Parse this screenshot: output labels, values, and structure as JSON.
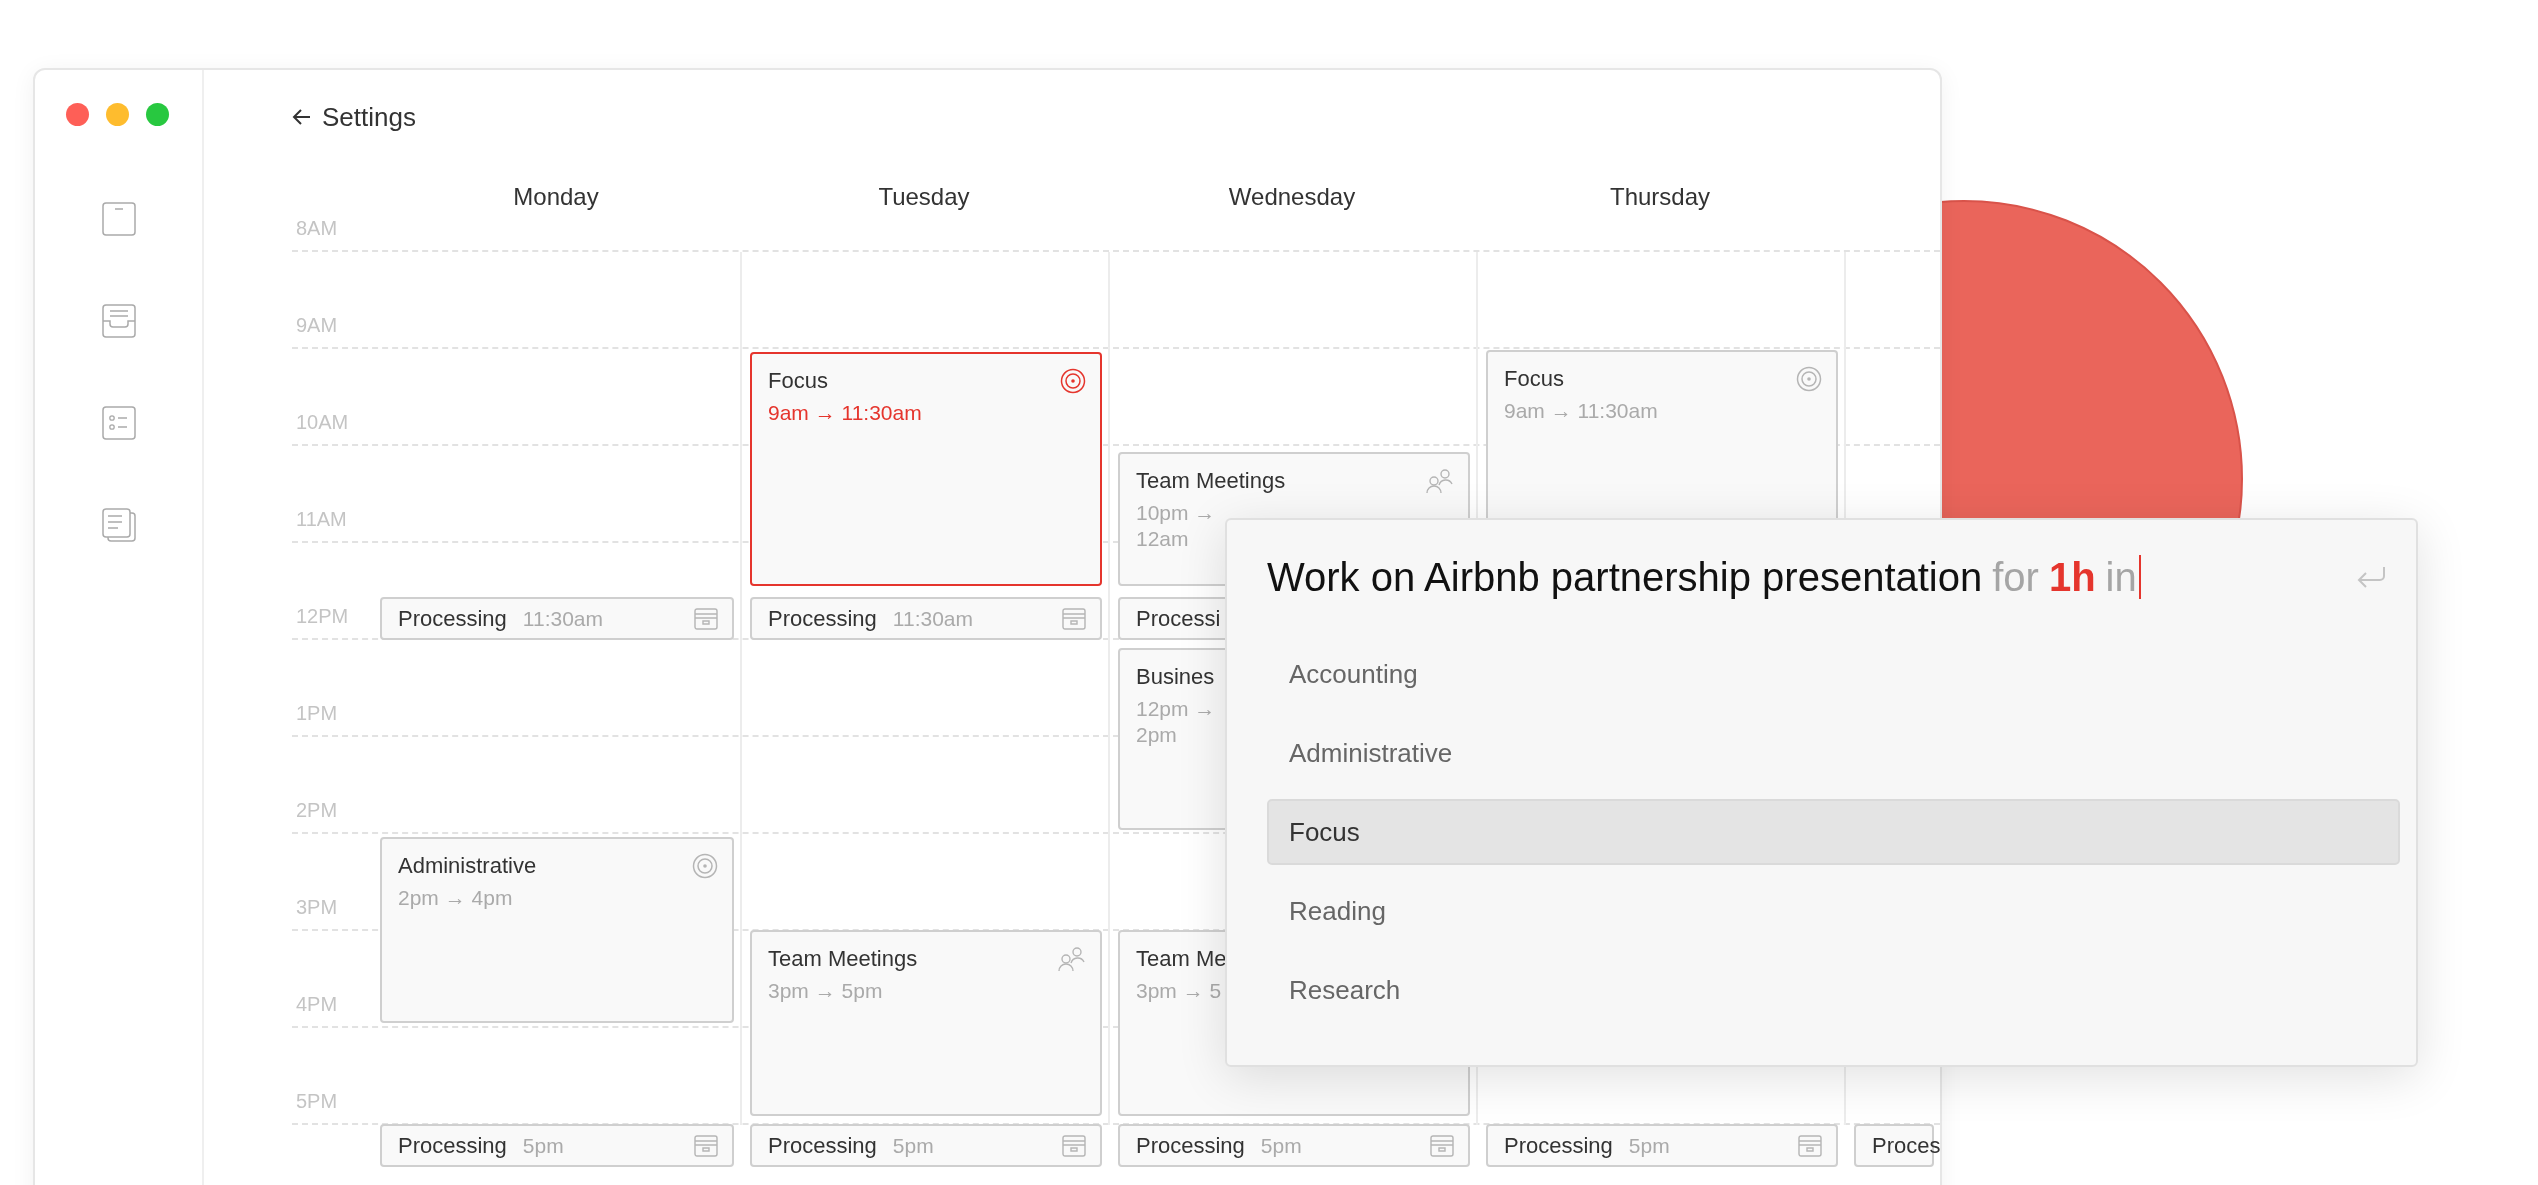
{
  "back_link": {
    "label": "Settings"
  },
  "sidebar": {
    "items": [
      {
        "selected": false
      },
      {
        "selected": false
      },
      {
        "selected": false
      },
      {
        "selected": false
      }
    ]
  },
  "hours": [
    "8AM",
    "9AM",
    "10AM",
    "11AM",
    "12PM",
    "1PM",
    "2PM",
    "3PM",
    "4PM",
    "5PM"
  ],
  "days": [
    {
      "name": "Monday",
      "events": [
        {
          "kind": "processing",
          "title": "Processing",
          "time": "11:30am",
          "selected": false
        },
        {
          "kind": "session",
          "title": "Administrative",
          "time": "2pm → 4pm",
          "selected": false
        },
        {
          "kind": "processing",
          "title": "Processing",
          "time": "5pm",
          "selected": false
        }
      ]
    },
    {
      "name": "Tuesday",
      "events": [
        {
          "kind": "session",
          "title": "Focus",
          "time": "9am → 11:30am",
          "selected": true
        },
        {
          "kind": "processing",
          "title": "Processing",
          "time": "11:30am",
          "selected": false
        },
        {
          "kind": "meeting",
          "title": "Team Meetings",
          "time": "3pm → 5pm",
          "selected": false
        },
        {
          "kind": "processing",
          "title": "Processing",
          "time": "5pm",
          "selected": false
        }
      ]
    },
    {
      "name": "Wednesday",
      "events": [
        {
          "kind": "meeting",
          "title": "Team Meetings",
          "time": "10pm →\n12am",
          "selected": false
        },
        {
          "kind": "bar",
          "title": "Processi",
          "selected": false
        },
        {
          "kind": "block",
          "title": "Busines",
          "time": "12pm →\n2pm",
          "selected": false
        },
        {
          "kind": "block",
          "title": "Team Me",
          "time": "3pm → 5",
          "selected": false
        },
        {
          "kind": "processing",
          "title": "Processing",
          "time": "5pm",
          "selected": false
        }
      ]
    },
    {
      "name": "Thursday",
      "events": [
        {
          "kind": "session",
          "title": "Focus",
          "time": "9am → 11:30am",
          "selected": false
        },
        {
          "kind": "processing",
          "title": "Processing",
          "time": "5pm",
          "selected": false
        }
      ]
    },
    {
      "events": [
        {
          "kind": "bar",
          "title": "Proces",
          "selected": false
        }
      ]
    }
  ],
  "command_palette": {
    "text": "Work on Airbnb partnership presentation",
    "for_word": "for",
    "duration": "1h",
    "in_word": "in",
    "options": [
      {
        "label": "Accounting",
        "selected": false
      },
      {
        "label": "Administrative",
        "selected": false
      },
      {
        "label": "Focus",
        "selected": true
      },
      {
        "label": "Reading",
        "selected": false
      },
      {
        "label": "Research",
        "selected": false
      }
    ]
  }
}
